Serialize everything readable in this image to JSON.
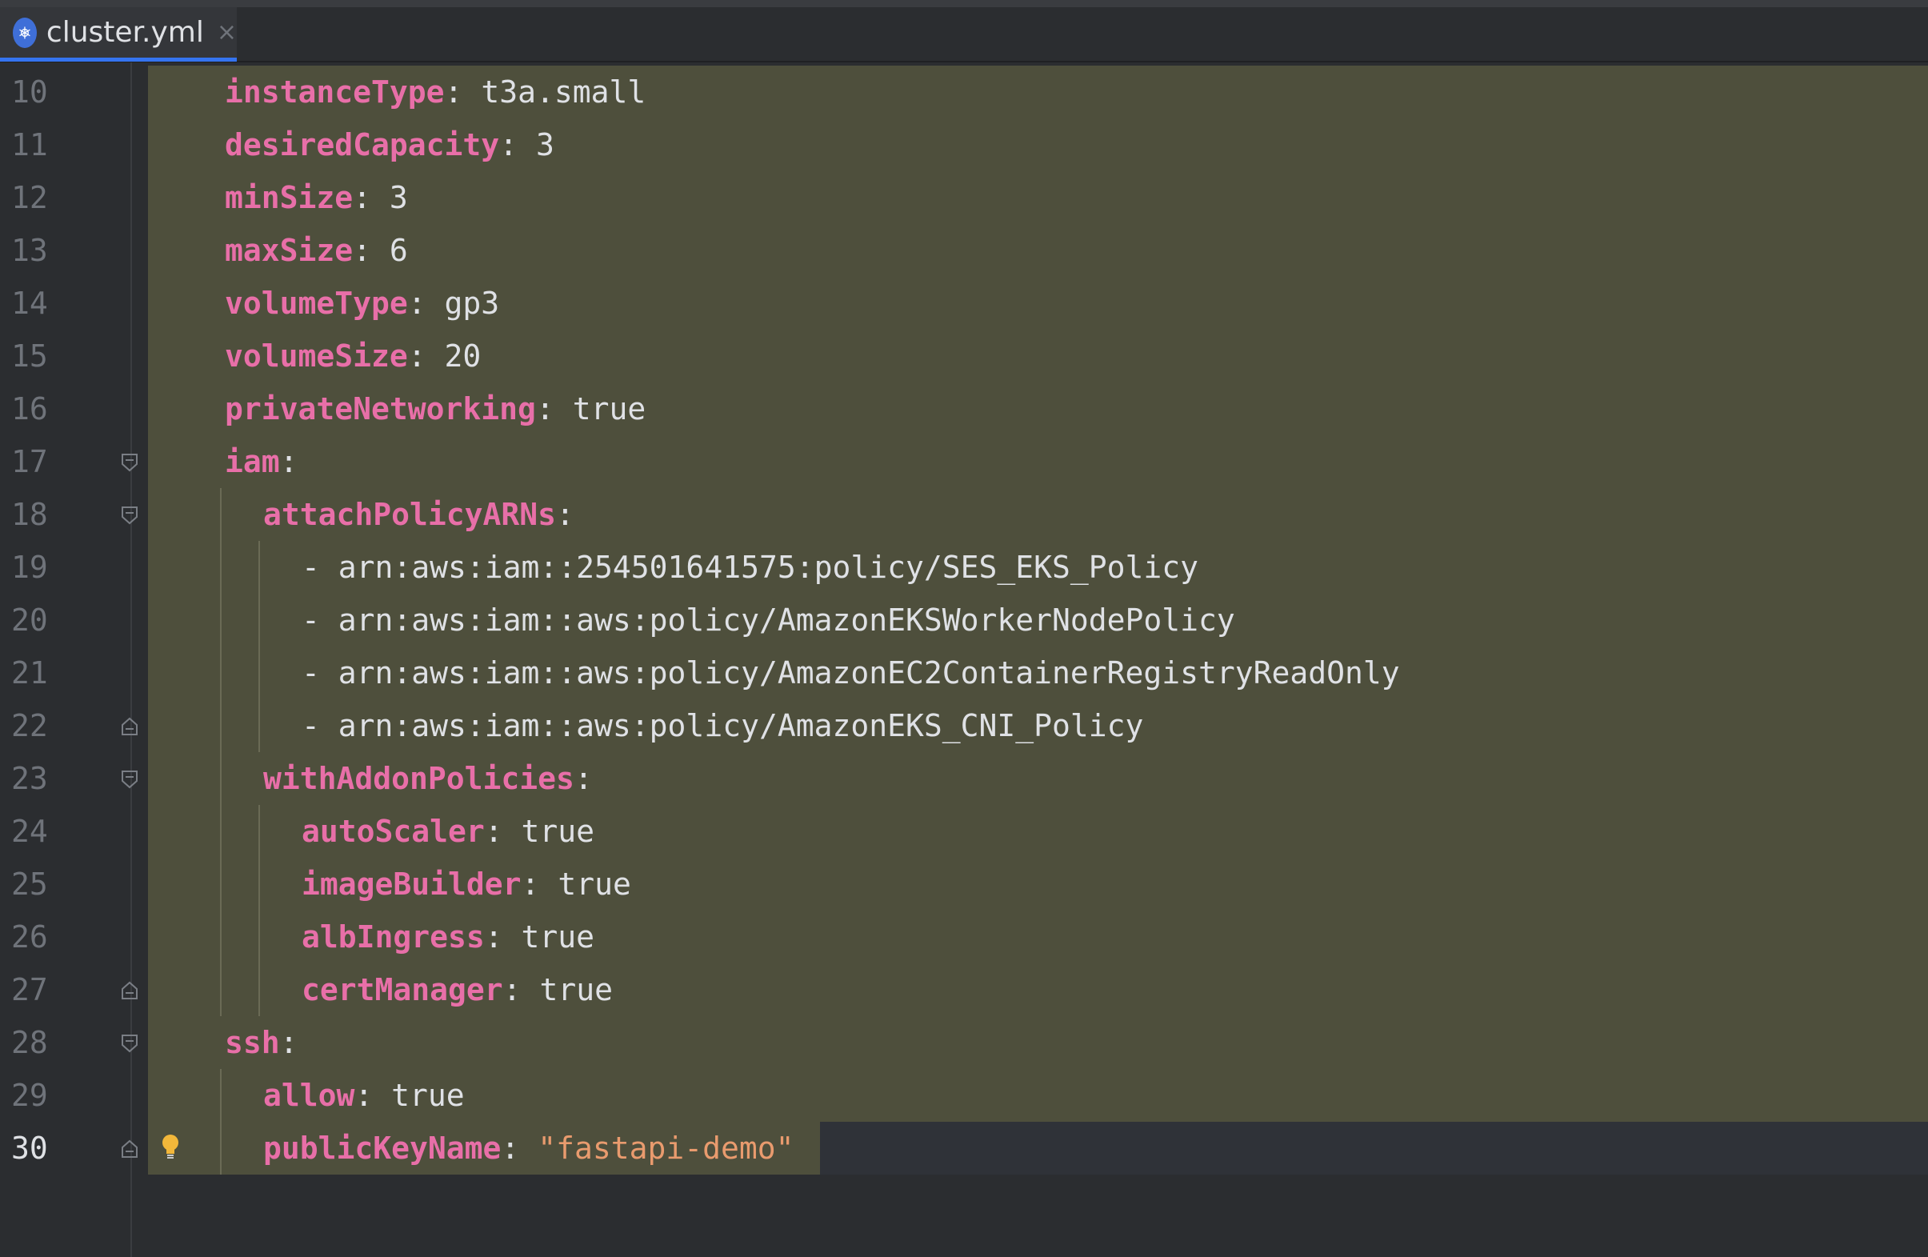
{
  "tab": {
    "icon": "kubernetes-icon",
    "filename": "cluster.yml",
    "close_glyph": "×"
  },
  "lines": [
    {
      "n": "10",
      "indent": 0,
      "key": "instanceType",
      "sep": ": ",
      "value": "t3a.small",
      "fold": ""
    },
    {
      "n": "11",
      "indent": 0,
      "key": "desiredCapacity",
      "sep": ": ",
      "value": "3",
      "fold": ""
    },
    {
      "n": "12",
      "indent": 0,
      "key": "minSize",
      "sep": ": ",
      "value": "3",
      "fold": ""
    },
    {
      "n": "13",
      "indent": 0,
      "key": "maxSize",
      "sep": ": ",
      "value": "6",
      "fold": ""
    },
    {
      "n": "14",
      "indent": 0,
      "key": "volumeType",
      "sep": ": ",
      "value": "gp3",
      "fold": ""
    },
    {
      "n": "15",
      "indent": 0,
      "key": "volumeSize",
      "sep": ": ",
      "value": "20",
      "fold": ""
    },
    {
      "n": "16",
      "indent": 0,
      "key": "privateNetworking",
      "sep": ": ",
      "value": "true",
      "fold": ""
    },
    {
      "n": "17",
      "indent": 0,
      "key": "iam",
      "sep": ":",
      "value": "",
      "fold": "open"
    },
    {
      "n": "18",
      "indent": 1,
      "key": "attachPolicyARNs",
      "sep": ":",
      "value": "",
      "fold": "open"
    },
    {
      "n": "19",
      "indent": 2,
      "key": "",
      "sep": "",
      "value": "- arn:aws:iam::254501641575:policy/SES_EKS_Policy",
      "fold": ""
    },
    {
      "n": "20",
      "indent": 2,
      "key": "",
      "sep": "",
      "value": "- arn:aws:iam::aws:policy/AmazonEKSWorkerNodePolicy",
      "fold": ""
    },
    {
      "n": "21",
      "indent": 2,
      "key": "",
      "sep": "",
      "value": "- arn:aws:iam::aws:policy/AmazonEC2ContainerRegistryReadOnly",
      "fold": ""
    },
    {
      "n": "22",
      "indent": 2,
      "key": "",
      "sep": "",
      "value": "- arn:aws:iam::aws:policy/AmazonEKS_CNI_Policy",
      "fold": "end"
    },
    {
      "n": "23",
      "indent": 1,
      "key": "withAddonPolicies",
      "sep": ":",
      "value": "",
      "fold": "open"
    },
    {
      "n": "24",
      "indent": 2,
      "key": "autoScaler",
      "sep": ": ",
      "value": "true",
      "fold": ""
    },
    {
      "n": "25",
      "indent": 2,
      "key": "imageBuilder",
      "sep": ": ",
      "value": "true",
      "fold": ""
    },
    {
      "n": "26",
      "indent": 2,
      "key": "albIngress",
      "sep": ": ",
      "value": "true",
      "fold": ""
    },
    {
      "n": "27",
      "indent": 2,
      "key": "certManager",
      "sep": ": ",
      "value": "true",
      "fold": "end"
    },
    {
      "n": "28",
      "indent": 0,
      "key": "ssh",
      "sep": ":",
      "value": "",
      "fold": "open"
    },
    {
      "n": "29",
      "indent": 1,
      "key": "allow",
      "sep": ": ",
      "value": "true",
      "fold": ""
    },
    {
      "n": "30",
      "indent": 1,
      "key": "publicKeyName",
      "sep": ": ",
      "value": "\"fastapi-demo\"",
      "string": true,
      "fold": "end",
      "current": true
    }
  ],
  "gutter_icons": {
    "intention": "lightbulb-icon"
  },
  "colors": {
    "editor_bg": "#2b2d30",
    "selection_bg": "#4e4f3c",
    "key": "#e86fa8",
    "string": "#e99b6e",
    "text": "#dfe1e5",
    "line_number": "#6f737a",
    "accent": "#3574f0"
  }
}
